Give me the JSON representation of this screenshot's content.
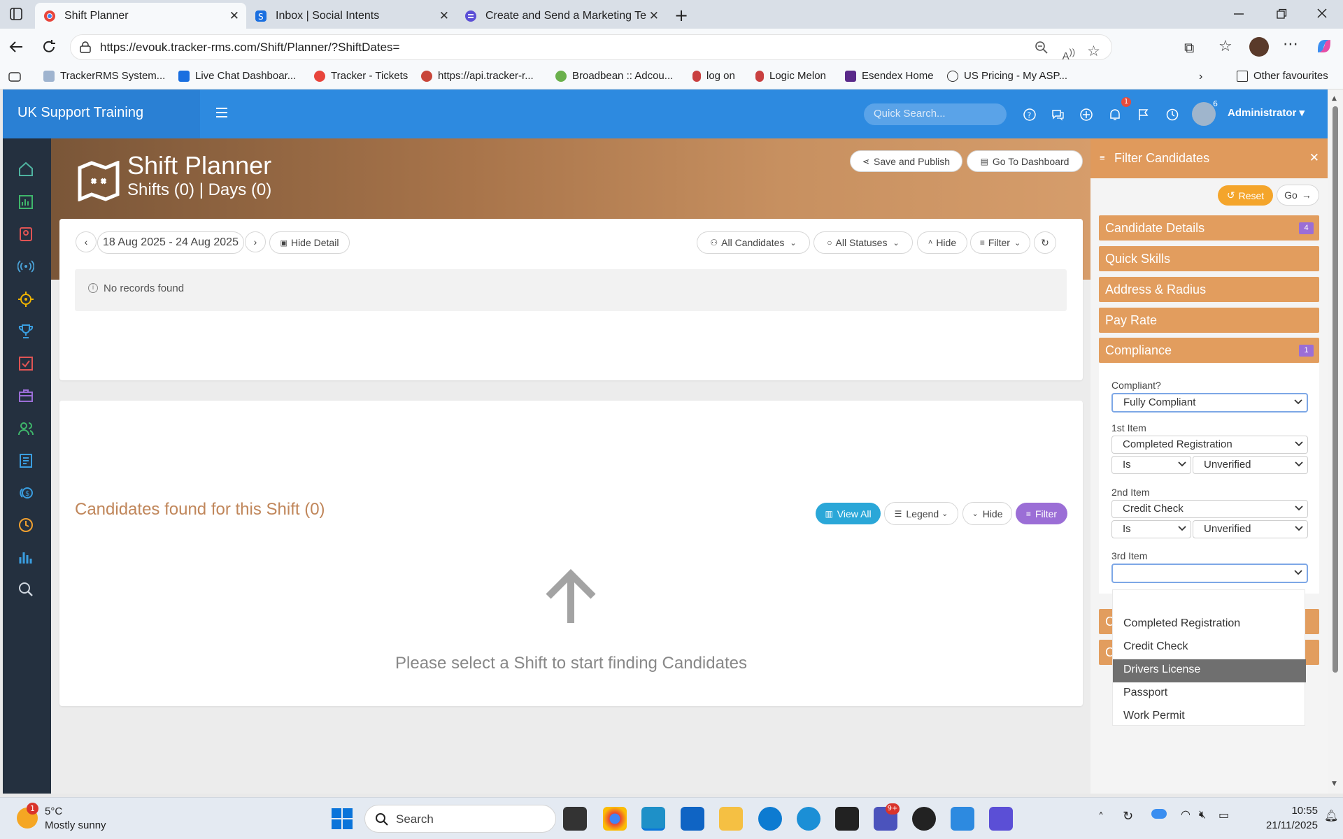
{
  "browser": {
    "tabs": [
      {
        "title": "Shift Planner",
        "active": true
      },
      {
        "title": "Inbox | Social Intents",
        "active": false
      },
      {
        "title": "Create and Send a Marketing Tem",
        "active": false
      }
    ],
    "url": "https://evouk.tracker-rms.com/Shift/Planner/?ShiftDates=",
    "bookmarks": [
      "TrackerRMS System...",
      "Live Chat Dashboar...",
      "Tracker - Tickets",
      "https://api.tracker-r...",
      "Broadbean :: Adcou...",
      "log on",
      "Logic Melon",
      "Esendex Home",
      "US Pricing - My ASP..."
    ],
    "other_favourites": "Other favourites"
  },
  "app": {
    "brand": "UK Support Training",
    "quick_search_placeholder": "Quick Search...",
    "notifications_count": "1",
    "avatar_count": "6",
    "user": "Administrator ▾"
  },
  "page": {
    "title": "Shift Planner",
    "subtitle": "Shifts (0) | Days (0)",
    "save_publish": "Save and Publish",
    "go_dashboard": "Go To Dashboard",
    "date_range": "18 Aug 2025 - 24 Aug 2025",
    "hide_detail": "Hide Detail",
    "all_candidates": "All Candidates",
    "all_statuses": "All Statuses",
    "hide": "Hide",
    "filter": "Filter",
    "no_records": "No records found",
    "candidates_title": "Candidates found for this Shift (0)",
    "view_all": "View All",
    "legend": "Legend",
    "hide2": "Hide",
    "filter2": "Filter",
    "empty_message": "Please select a Shift to start finding Candidates"
  },
  "filter_panel": {
    "title": "Filter Candidates",
    "reset": "Reset",
    "go": "Go",
    "sections": [
      {
        "label": "Candidate Details",
        "badge": "4"
      },
      {
        "label": "Quick Skills",
        "badge": ""
      },
      {
        "label": "Address & Radius",
        "badge": ""
      },
      {
        "label": "Pay Rate",
        "badge": ""
      },
      {
        "label": "Compliance",
        "badge": "1"
      }
    ],
    "compliant_label": "Compliant?",
    "compliant_value": "Fully Compliant",
    "item1_label": "1st Item",
    "item1_value": "Completed Registration",
    "item1_op": "Is",
    "item1_status": "Unverified",
    "item2_label": "2nd Item",
    "item2_value": "Credit Check",
    "item2_op": "Is",
    "item2_status": "Unverified",
    "item3_label": "3rd Item",
    "item3_value": "",
    "dropdown_options": [
      "",
      "Completed Registration",
      "Credit Check",
      "Drivers License",
      "Passport",
      "Work Permit"
    ],
    "dropdown_highlighted": "Drivers License",
    "hidden_section_initial_1": "C",
    "hidden_section_initial_2": "C"
  },
  "taskbar": {
    "temp": "5°C",
    "weather": "Mostly sunny",
    "weather_badge": "1",
    "search": "Search",
    "teams_badge": "9+",
    "time": "10:55",
    "date": "21/11/2025"
  },
  "colors": {
    "primary_blue": "#2d8ae0",
    "orange": "#e29d5e",
    "purple": "#9b6ed6",
    "teal": "#2aa7d8",
    "sidebar": "#24303f"
  }
}
